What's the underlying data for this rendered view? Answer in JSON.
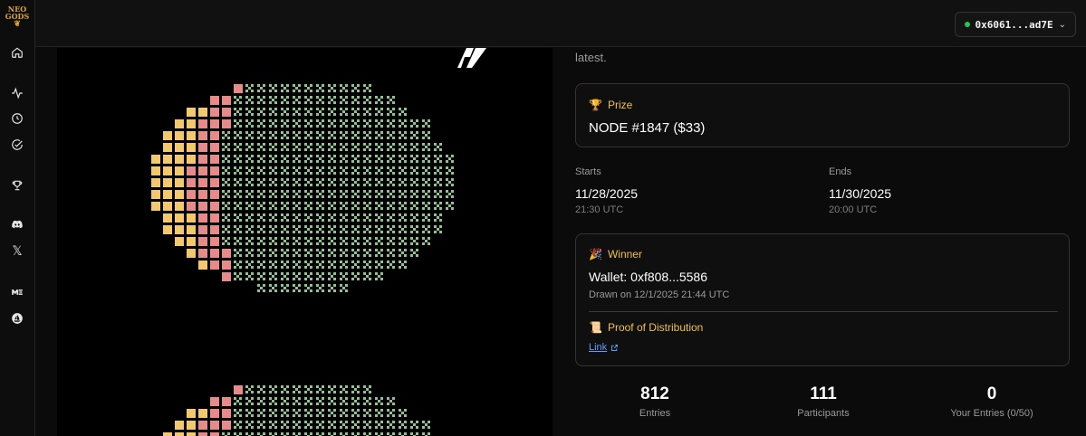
{
  "brand": {
    "logo_line1": "NEO",
    "logo_line2": "GODS"
  },
  "sidebar": {
    "icons": [
      "home-icon",
      "activity-icon",
      "clock-icon",
      "check-circle-icon",
      "trophy-icon",
      "discord-icon",
      "x-icon",
      "magic-eden-icon",
      "opensea-icon"
    ],
    "x_glyph": "𝕏"
  },
  "header": {
    "wallet": {
      "address": "0x6061...ad7E",
      "status_color": "#22c55e"
    }
  },
  "content": {
    "intro_tail": "latest.",
    "prize": {
      "emoji": "🏆",
      "label": "Prize",
      "value": "NODE #1847 ($33)"
    },
    "schedule": {
      "starts_label": "Starts",
      "starts_date": "11/28/2025",
      "starts_time": "21:30 UTC",
      "ends_label": "Ends",
      "ends_date": "11/30/2025",
      "ends_time": "20:00 UTC"
    },
    "winner": {
      "emoji": "🎉",
      "label": "Winner",
      "wallet": "Wallet: 0xf808...5586",
      "drawn": "Drawn on 12/1/2025 21:44 UTC",
      "proof_emoji": "📜",
      "proof_label": "Proof of Distribution",
      "link_label": "Link"
    },
    "stats": [
      {
        "value": "812",
        "label": "Entries"
      },
      {
        "value": "111",
        "label": "Participants"
      },
      {
        "value": "0",
        "label": "Your Entries (0/50)"
      }
    ]
  },
  "colors": {
    "accent": "#f0c14b",
    "link": "#5aa0ff",
    "pixel_yellow": "#f4c96b",
    "pixel_pink": "#e88a8a",
    "pixel_green": "#8fc28f"
  }
}
